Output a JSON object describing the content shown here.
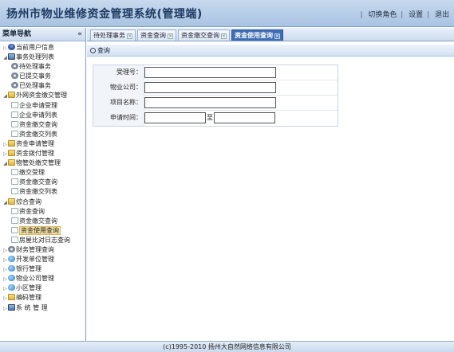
{
  "header": {
    "title": "扬州市物业维修资金管理系统(管理端)",
    "links": [
      "切换角色",
      "设置",
      "退出"
    ]
  },
  "sidebar": {
    "title": "菜单导航",
    "collapse_icon": "double-chevron-left-icon",
    "items": [
      {
        "label": "当前用户信息",
        "level": 1,
        "icon": "user-icon",
        "toggle": "▷"
      },
      {
        "label": "事务处理列表",
        "level": 1,
        "icon": "pc-icon",
        "toggle": "◢"
      },
      {
        "label": "待处理事务",
        "level": 2,
        "icon": "gear-icon"
      },
      {
        "label": "已提交事务",
        "level": 2,
        "icon": "gear-icon"
      },
      {
        "label": "已处理事务",
        "level": 2,
        "icon": "gear-icon"
      },
      {
        "label": "外网资金缴交管理",
        "level": 1,
        "icon": "folder-icon",
        "toggle": "◢"
      },
      {
        "label": "企业申请受理",
        "level": 2,
        "icon": "page-icon"
      },
      {
        "label": "企业申请列表",
        "level": 2,
        "icon": "page-icon"
      },
      {
        "label": "资金缴交查询",
        "level": 2,
        "icon": "page-icon"
      },
      {
        "label": "资金缴交列表",
        "level": 2,
        "icon": "page-icon"
      },
      {
        "label": "资金申请管理",
        "level": 1,
        "icon": "folder-icon",
        "toggle": "▷"
      },
      {
        "label": "资金拨付管理",
        "level": 1,
        "icon": "folder-icon",
        "toggle": "▷"
      },
      {
        "label": "物管处缴交管理",
        "level": 1,
        "icon": "folder-icon",
        "toggle": "◢"
      },
      {
        "label": "缴交受理",
        "level": 2,
        "icon": "page-icon"
      },
      {
        "label": "资金缴交查询",
        "level": 2,
        "icon": "page-icon"
      },
      {
        "label": "资金缴交列表",
        "level": 2,
        "icon": "page-icon"
      },
      {
        "label": "综合查询",
        "level": 1,
        "icon": "folder-icon",
        "toggle": "◢"
      },
      {
        "label": "资金查询",
        "level": 2,
        "icon": "page-icon"
      },
      {
        "label": "资金缴交查询",
        "level": 2,
        "icon": "page-icon"
      },
      {
        "label": "资金使用查询",
        "level": 2,
        "icon": "page-icon",
        "selected": true
      },
      {
        "label": "房屋比对日志查询",
        "level": 2,
        "icon": "page-icon"
      },
      {
        "label": "财务管理查询",
        "level": 1,
        "icon": "gear-icon",
        "toggle": "▷"
      },
      {
        "label": "开发单位管理",
        "level": 1,
        "icon": "globe-icon",
        "toggle": "▷"
      },
      {
        "label": "银行管理",
        "level": 1,
        "icon": "globe-icon",
        "toggle": "▷"
      },
      {
        "label": "物业公司管理",
        "level": 1,
        "icon": "globe-icon",
        "toggle": "▷"
      },
      {
        "label": "小区管理",
        "level": 1,
        "icon": "globe-icon",
        "toggle": "▷"
      },
      {
        "label": "编码管理",
        "level": 1,
        "icon": "folder-icon",
        "toggle": "▷"
      },
      {
        "label": "系 统 管 理",
        "level": 1,
        "icon": "pc-icon",
        "toggle": "▷"
      }
    ]
  },
  "tabs": [
    {
      "label": "待处理事务",
      "active": false
    },
    {
      "label": "资金查询",
      "active": false
    },
    {
      "label": "资金缴交查询",
      "active": false
    },
    {
      "label": "资金使用查询",
      "active": true
    }
  ],
  "panel": {
    "title": "查询",
    "icon": "search-icon"
  },
  "form": {
    "fields": [
      {
        "label": "受理号：",
        "value": ""
      },
      {
        "label": "物业公司：",
        "value": ""
      },
      {
        "label": "项目名称：",
        "value": ""
      }
    ],
    "date": {
      "label": "申请时间：",
      "from": "",
      "sep": "至",
      "to": ""
    }
  },
  "footer": {
    "text": "(c)1995-2010 扬州大自然网络信息有限公司"
  }
}
